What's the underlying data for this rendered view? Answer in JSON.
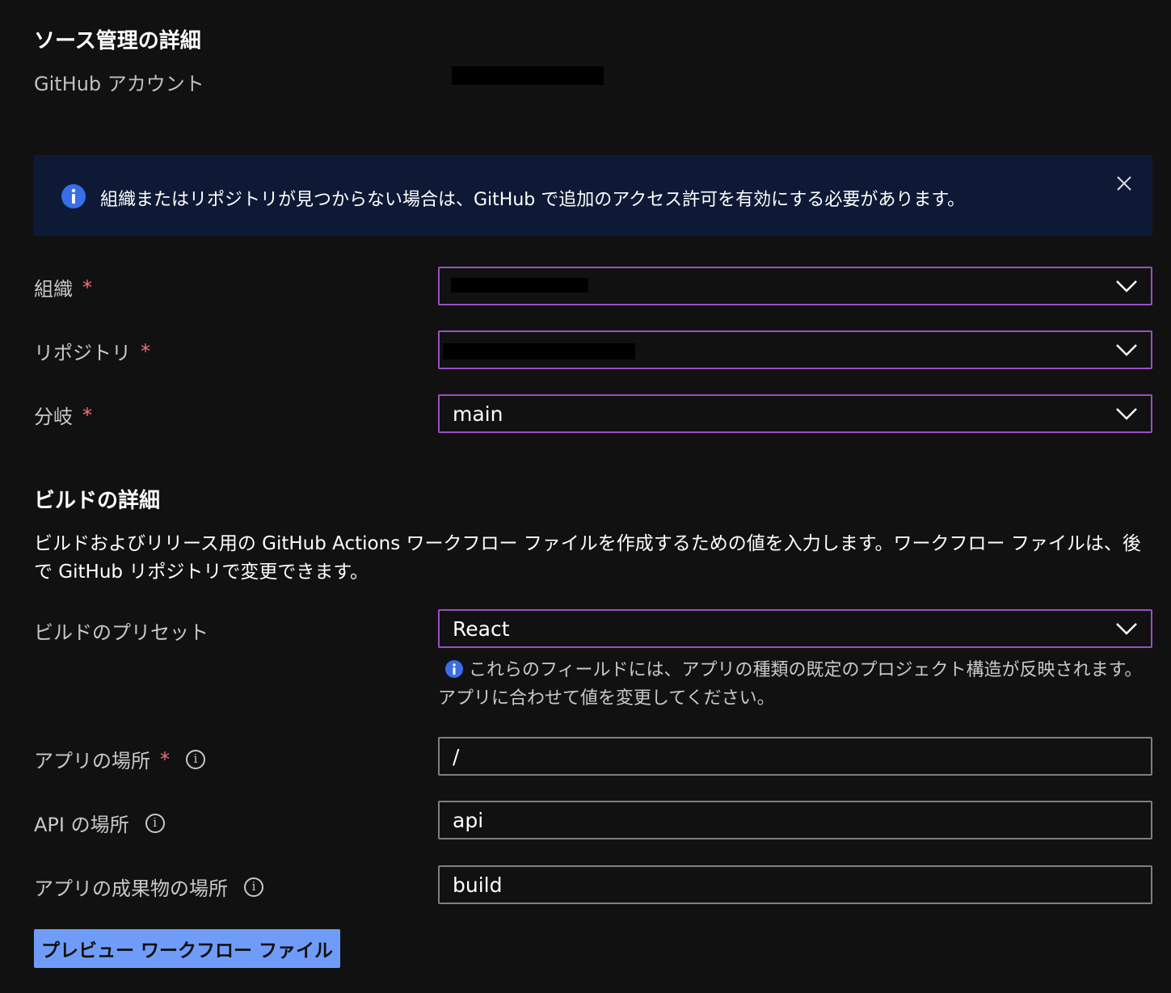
{
  "source": {
    "title": "ソース管理の詳細",
    "github_account_label": "GitHub アカウント"
  },
  "banner": {
    "text": "組織またはリポジトリが見つからない場合は、GitHub で追加のアクセス許可を有効にする必要があります。",
    "info_icon": "info-icon",
    "close_icon": "close-icon"
  },
  "fields": {
    "organization": {
      "label": "組織",
      "required_mark": "*"
    },
    "repository": {
      "label": "リポジトリ",
      "required_mark": "*"
    },
    "branch": {
      "label": "分岐",
      "required_mark": "*",
      "value": "main"
    }
  },
  "build": {
    "title": "ビルドの詳細",
    "description": "ビルドおよびリリース用の GitHub Actions ワークフロー ファイルを作成するための値を入力します。ワークフロー ファイルは、後で GitHub リポジトリで変更できます。",
    "preset": {
      "label": "ビルドのプリセット",
      "value": "React",
      "hint": "これらのフィールドには、アプリの種類の既定のプロジェクト構造が反映されます。アプリに合わせて値を変更してください。"
    },
    "app_location": {
      "label": "アプリの場所",
      "required_mark": "*",
      "value": "/"
    },
    "api_location": {
      "label": "API の場所",
      "value": "api"
    },
    "output_location": {
      "label": "アプリの成果物の場所",
      "value": "build"
    },
    "info_glyph": "i"
  },
  "preview_button": {
    "label": "プレビュー ワークフロー ファイル"
  },
  "colors": {
    "background": "#111111",
    "banner_bg": "#0e1a35",
    "focus_border": "#9b4fc1",
    "required": "#f1707b",
    "info_blue": "#3a6ee8",
    "button_bg": "#6f9cf8"
  }
}
